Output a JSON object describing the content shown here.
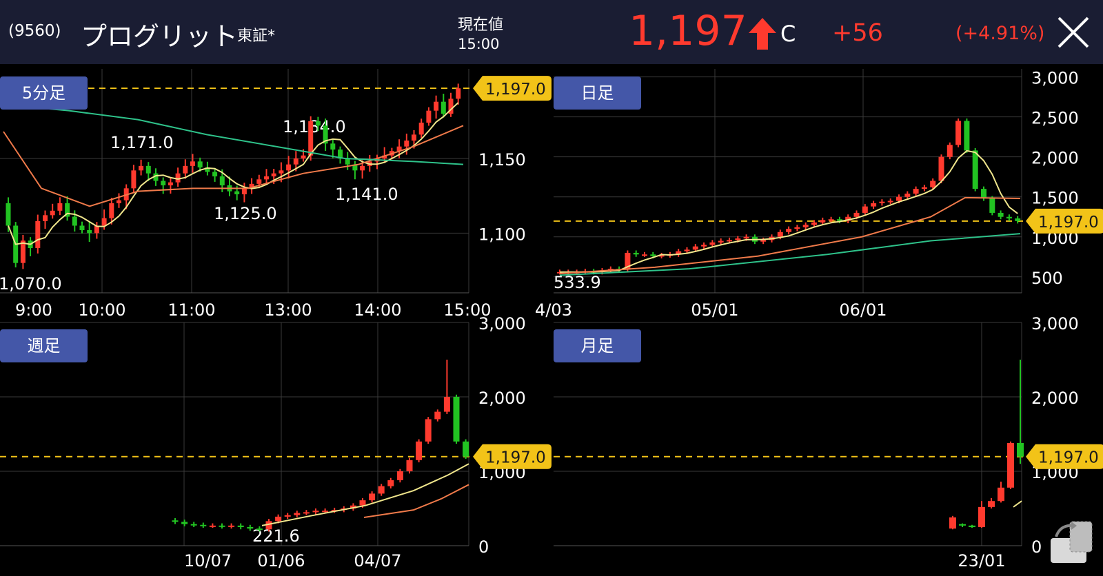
{
  "header": {
    "code": "(9560)",
    "name": "プログリット",
    "market": "東証*",
    "price_label": "現在値",
    "price_time": "15:00",
    "price": "1,197",
    "price_flag": "C",
    "change": "+56",
    "change_pct": "(+4.91%)",
    "arrow_icon": "up-arrow-icon",
    "close_icon": "close-icon"
  },
  "colors": {
    "up": "#ff3a2e",
    "down": "#22c322",
    "ma_short": "#f0e68c",
    "ma_mid": "#f07a4a",
    "ma_long": "#2ec28a",
    "current_line": "#f2c318",
    "badge": "#4457a8",
    "header_bg": "#1a1d33"
  },
  "panels": [
    {
      "id": "intraday",
      "label": "5分足",
      "price_tag": "1,197.0",
      "current": 1197,
      "y_ticks": [
        "1,150",
        "1,100"
      ],
      "y_tick_values": [
        1150,
        1100
      ],
      "x_ticks": [
        "9:00",
        "10:00",
        "11:00",
        "13:00",
        "14:00",
        "15:00"
      ],
      "annotations": [
        {
          "text": "1,070.0",
          "value": 1070
        },
        {
          "text": "1,171.0",
          "value": 1171
        },
        {
          "text": "1,125.0",
          "value": 1125
        },
        {
          "text": "1,184.0",
          "value": 1184
        },
        {
          "text": "1,141.0",
          "value": 1141
        }
      ]
    },
    {
      "id": "daily",
      "label": "日足",
      "price_tag": "1,197.0",
      "current": 1197,
      "y_ticks": [
        "3,000",
        "2,500",
        "2,000",
        "1,500",
        "1,000",
        "500"
      ],
      "y_tick_values": [
        3000,
        2500,
        2000,
        1500,
        1000,
        500
      ],
      "x_ticks": [
        "4/03",
        "05/01",
        "06/01"
      ],
      "annotations": [
        {
          "text": "533.9",
          "value": 533.9
        }
      ]
    },
    {
      "id": "weekly",
      "label": "週足",
      "price_tag": "1,197.0",
      "current": 1197,
      "y_ticks": [
        "3,000",
        "2,000",
        "1,000",
        "0"
      ],
      "y_tick_values": [
        3000,
        2000,
        1000,
        0
      ],
      "x_ticks": [
        "10/07",
        "01/06",
        "04/07"
      ],
      "annotations": [
        {
          "text": "221.6",
          "value": 221.6
        }
      ]
    },
    {
      "id": "monthly",
      "label": "月足",
      "price_tag": "1,197.0",
      "current": 1197,
      "y_ticks": [
        "3,000",
        "2,000",
        "1,000",
        "0"
      ],
      "y_tick_values": [
        3000,
        2000,
        1000,
        0
      ],
      "x_ticks": [
        "23/01"
      ],
      "annotations": []
    }
  ],
  "rotate_icon": "rotate-screen-icon"
}
